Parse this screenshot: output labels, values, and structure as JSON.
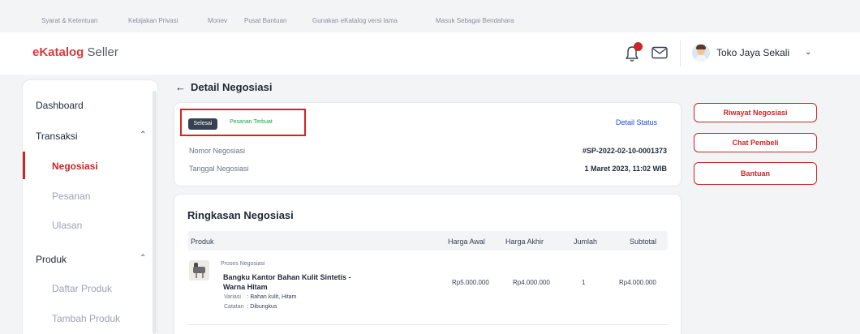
{
  "top_links": [
    "Syarat & Ketentuan",
    "Kebijakan Privasi",
    "Monev",
    "Pusat Bantuan",
    "Gunakan eKatalog versi lama",
    "Masuk Sebagai Bendahara"
  ],
  "header": {
    "logo_brand": "eKatalog",
    "logo_suffix": "Seller",
    "notification_icon": "bell-icon",
    "mail_icon": "mail-icon",
    "store_name": "Toko Jaya Sekali",
    "store_menu_icon": "chevron-down-icon"
  },
  "sidebar": {
    "dashboard": "Dashboard",
    "transaksi": "Transaksi",
    "transaksi_items": [
      "Negosiasi",
      "Pesanan",
      "Ulasan"
    ],
    "active_item": "Negosiasi",
    "produk": "Produk",
    "produk_items": [
      "Daftar Produk",
      "Tambah Produk"
    ]
  },
  "page": {
    "back_icon": "arrow-left-icon",
    "title": "Detail Negosiasi"
  },
  "status_card": {
    "badge_status": "Selesai",
    "badge_order": "Pesanan Terbuat",
    "detail_status_link": "Detail Status",
    "nomor_label": "Nomor Negosiasi",
    "nomor_value": "#SP-2022-02-10-0001373",
    "tanggal_label": "Tanggal Negosiasi",
    "tanggal_value": "1 Maret 2023, 11:02 WIB"
  },
  "summary": {
    "title": "Ringkasan Negosiasi",
    "columns": [
      "Produk",
      "Harga Awal",
      "Harga Akhir",
      "Jumlah",
      "Subtotal"
    ],
    "items": [
      {
        "status_tag": "Proses Negosiasi",
        "name": "Bangku Kantor Bahan Kulit Sintetis - Warna Hitam",
        "variasi_label": "Variasi",
        "variasi_value": ": Bahan kulit, Hitam",
        "catatan_label": "Catatan",
        "catatan_value": ": Dibungkus",
        "harga_awal": "Rp5.000.000",
        "harga_akhir": "Rp4.000.000",
        "jumlah": "1",
        "subtotal": "Rp4.000.000"
      }
    ]
  },
  "actions": {
    "riwayat": "Riwayat Negosiasi",
    "chat": "Chat Pembeli",
    "bantuan": "Bantuan"
  },
  "colors": {
    "brand_red": "#c62828",
    "link_blue": "#1d4ed8",
    "success_green": "#16a34a",
    "dark_badge": "#374151"
  }
}
